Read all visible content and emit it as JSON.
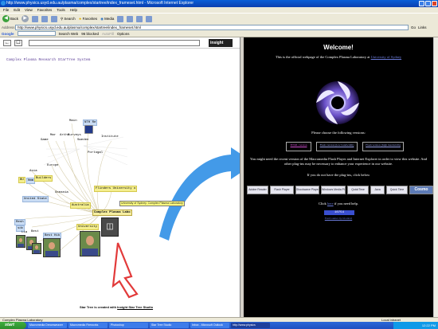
{
  "window": {
    "title": "http://www.physics.usyd.edu.au/plasma/complex/startree/index_frameset.html - Microsoft Internet Explorer"
  },
  "menu": [
    "File",
    "Edit",
    "View",
    "Favorites",
    "Tools",
    "Help"
  ],
  "toolbar": {
    "back": "Back",
    "search": "Search",
    "favorites": "Favorites",
    "media": "Media"
  },
  "address": {
    "label": "Address",
    "url": "http://www.physics.usyd.edu.au/plasma/complex/startree/index_frameset.html",
    "go": "Go",
    "links": "Links"
  },
  "google": {
    "logo": "Google",
    "search_web": "Search Web",
    "blocked": "96 blocked",
    "autofill": "AutoFill",
    "options": "Options"
  },
  "startree": {
    "insight": "insight",
    "title": "Complex Plasma Research StarTree System",
    "nodes": {
      "main": "Main",
      "nth": "NTH Re",
      "institute": "Institute",
      "game": "Game",
      "surveys": "Surveys",
      "sweden": "Sweden",
      "portugal": "Portugal",
      "europe": "Europe",
      "asia": "Asia",
      "builder": "Builders",
      "united_states": "United State",
      "oceania": "Oceania",
      "flinders": "Flinders University o",
      "australia": "Australia",
      "complex_plasma_lab": "Complex Plasma Labo",
      "university": "University",
      "resh": "Resh",
      "sdc": "sdc",
      "best": "Best",
      "exhibit": "Best Hib",
      "lia": "Lia"
    },
    "tooltip": "University of Sydney, Complex Plasma Laboratory",
    "credit_prefix": "Star Tree  is created with ",
    "credit_link": "Inxight Star Tree Studio"
  },
  "right": {
    "welcome": "Welcome!",
    "intro": "This is the official webpage of the Complex Plasma Laboratory at ",
    "intro_link": "University of Sydney",
    "choose": "Please choose the following versions:",
    "versions": [
      "HTML version",
      "Flash version (low bandwidth)",
      "Flash version (high bandwidth)"
    ],
    "flash_note": "You might need the recent version of the Macromedia Flash Player and Internet Explorer in order to view this website. And other plug-ins may be necessary to enhance your experience in our website.",
    "plugins_note": "If you do not have the plug-ins, click below",
    "plugins": [
      "Adobe Reader",
      "Flash Player",
      "Shockwave Player",
      "Windows Media Player",
      "QuickTime",
      "Java",
      "Quick Time",
      "Cosmo"
    ],
    "help_prefix": "Click ",
    "help_link": "here",
    "help_suffix": " if you need help.",
    "counter": "10754",
    "counter_caption": "FastCounter by bCentral"
  },
  "status": {
    "left": "Complex Plasma Laboratory",
    "zone": "Local intranet"
  },
  "taskbar": {
    "start": "start",
    "tasks": [
      "Macromedia Dreamweaver",
      "Macromedia Fireworks",
      "Photoshop",
      "Star Tree Studio",
      "Inbox - Microsoft Outlook",
      "http://www.physics"
    ],
    "clock": "12:22 PM"
  },
  "colors": {
    "title_blue": "#0a5fd8",
    "startree_purple": "#5a3c96",
    "right_bg": "#000000",
    "link_blue": "#6b7bd9",
    "arrow_blue": "#2f8fe6",
    "taskbar_blue": "#2b68d8",
    "start_green": "#3fae3f"
  }
}
